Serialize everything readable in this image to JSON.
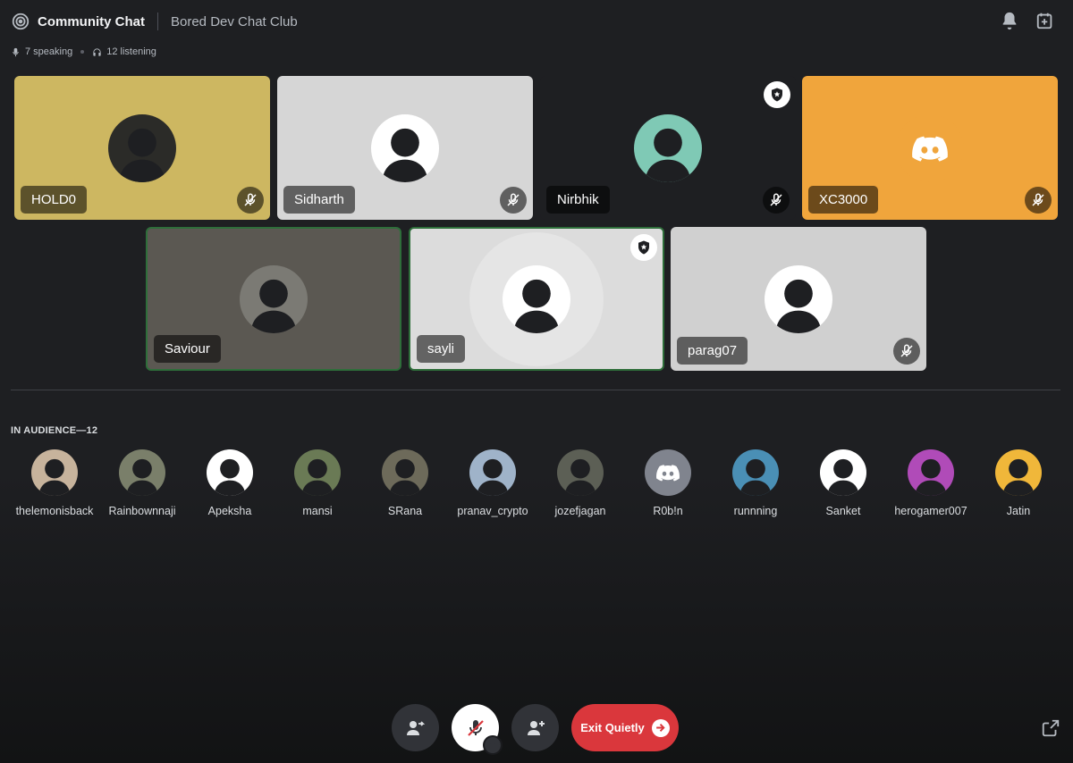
{
  "header": {
    "channel_title": "Community Chat",
    "server_name": "Bored Dev Chat Club",
    "icons": [
      "stage-icon",
      "bell-icon",
      "calendar-add-icon"
    ]
  },
  "stats": {
    "speaking": "7 speaking",
    "listening": "12 listening"
  },
  "speakers": [
    {
      "name": "HOLD0",
      "bg": "#cdb761",
      "muted": true,
      "moderator": false,
      "speaking": false
    },
    {
      "name": "Sidharth",
      "bg": "#d6d6d6",
      "muted": true,
      "moderator": false,
      "speaking": false
    },
    {
      "name": "Nirbhik",
      "bg": "#1e1f22",
      "muted": true,
      "moderator": true,
      "speaking": false
    },
    {
      "name": "XC3000",
      "bg": "#f0a53c",
      "muted": true,
      "moderator": false,
      "speaking": false
    },
    {
      "name": "Saviour",
      "bg": "#5b5852",
      "muted": false,
      "moderator": false,
      "speaking": true
    },
    {
      "name": "sayli",
      "bg": "#dcdcdc",
      "muted": false,
      "moderator": true,
      "speaking": true
    },
    {
      "name": "parag07",
      "bg": "#d0d0d0",
      "muted": true,
      "moderator": false,
      "speaking": false
    }
  ],
  "audience": {
    "title": "IN AUDIENCE—12",
    "members": [
      {
        "name": "thelemonisback",
        "color": "#c7b39c"
      },
      {
        "name": "Rainbownnaji",
        "color": "#7a7f6a"
      },
      {
        "name": "Apeksha",
        "color": "#ffffff"
      },
      {
        "name": "mansi",
        "color": "#6a7a55"
      },
      {
        "name": "SRana",
        "color": "#6d6a5a"
      },
      {
        "name": "pranav_crypto",
        "color": "#9fb3c9"
      },
      {
        "name": "jozefjagan",
        "color": "#5c5f55"
      },
      {
        "name": "R0b!n",
        "color": "#80848e"
      },
      {
        "name": "runnning",
        "color": "#4a8fb5"
      },
      {
        "name": "Sanket",
        "color": "#ffffff"
      },
      {
        "name": "herogamer007",
        "color": "#b04bb8"
      },
      {
        "name": "Jatin",
        "color": "#f0b73a"
      }
    ]
  },
  "controls": {
    "exit_label": "Exit Quietly",
    "icons": [
      "move-to-audience-icon",
      "mic-muted-icon",
      "invite-icon",
      "arrow-right-icon",
      "popout-icon"
    ]
  },
  "colors": {
    "exit": "#da373c",
    "speaking_border": "#2e6e3a",
    "background": "#1e1f22"
  }
}
